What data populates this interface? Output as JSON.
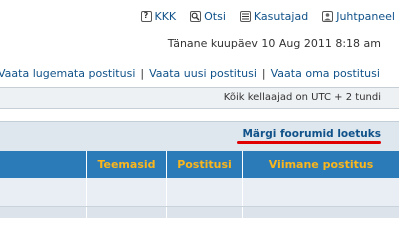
{
  "topnav": {
    "faq": {
      "label": "KKK",
      "icon": "faq-icon"
    },
    "search": {
      "label": "Otsi",
      "icon": "search-icon"
    },
    "members": {
      "label": "Kasutajad",
      "icon": "members-list-icon"
    },
    "ucp": {
      "label": "Juhtpaneel",
      "icon": "user-control-panel-icon"
    }
  },
  "date_text": "Tänane kuupäev 10 Aug 2011 8:18 am",
  "links": {
    "unread": "Vaata lugemata postitusi",
    "new": "Vaata uusi postitusi",
    "own": "Vaata oma postitusi",
    "separator": "|"
  },
  "timezone_text": "Kõik kellaajad on UTC + 2 tundi",
  "mark_forums_read": "Märgi foorumid loetuks",
  "table_headers": {
    "topics": "Teemasid",
    "posts": "Postitusi",
    "last_post": "Viimane postitus"
  },
  "colors": {
    "link": "#105289",
    "header_bg": "#2b7bb9",
    "header_text": "#fbb61b",
    "highlight_line": "#e00000"
  }
}
